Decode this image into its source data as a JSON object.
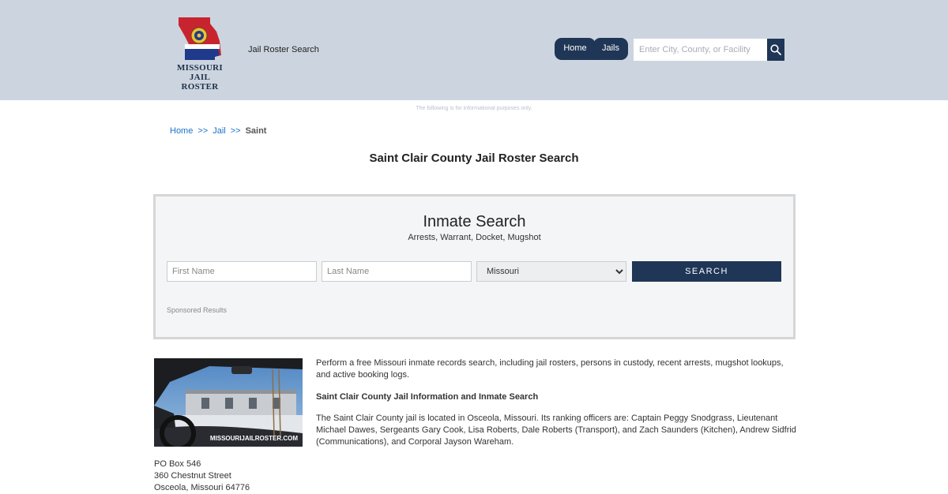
{
  "header": {
    "logo_line1": "MISSOURI",
    "logo_line2": "JAIL ROSTER",
    "site_name": "Jail Roster Search",
    "nav": [
      {
        "label": "Home"
      },
      {
        "label": "Jails"
      }
    ],
    "search_placeholder": "Enter City, County, or Facility",
    "brand_color": "#1f3656",
    "header_bg": "#ccd5df"
  },
  "disclaimer": "The following is for informational purposes only.",
  "breadcrumb": {
    "home": "Home",
    "sep": ">>",
    "jail": "Jail",
    "current": "Saint"
  },
  "page_title": "Saint Clair County Jail Roster Search",
  "inmate_search": {
    "title": "Inmate Search",
    "subtitle": "Arrests, Warrant, Docket, Mugshot",
    "first_name_placeholder": "First Name",
    "last_name_placeholder": "Last Name",
    "state_selected": "Missouri",
    "button_label": "SEARCH",
    "sponsored_label": "Sponsored Results"
  },
  "photo": {
    "watermark": "MISSOURIJAILROSTER.COM"
  },
  "info": {
    "intro": "Perform a free Missouri inmate records search, including jail rosters, persons in custody, recent arrests, mugshot lookups, and active booking logs.",
    "heading": "Saint Clair County Jail Information and Inmate Search",
    "details": "The Saint Clair County jail is located in Osceola, Missouri. Its ranking officers are: Captain Peggy Snodgrass, Lieutenant Michael Dawes, Sergeants Gary Cook, Lisa Roberts, Dale Roberts (Transport), and Zach Saunders (Kitchen), Andrew Sidfrid (Communications), and Corporal Jayson Wareham."
  },
  "address": {
    "line1": "PO Box 546",
    "line2": "360 Chestnut Street",
    "line3": "Osceola, Missouri 64776"
  }
}
